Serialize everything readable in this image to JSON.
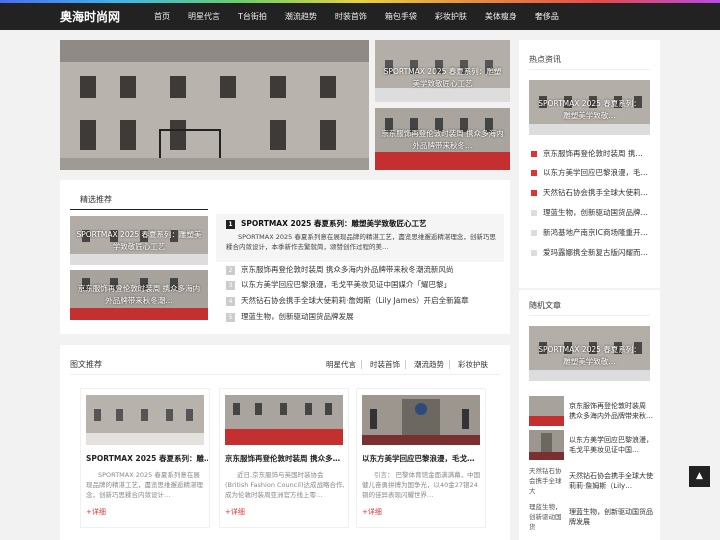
{
  "logo": "奥海时尚网",
  "nav": [
    "首页",
    "明星代言",
    "T台街拍",
    "潮流趋势",
    "时装首饰",
    "箱包手袋",
    "彩妆护肤",
    "美体瘦身",
    "奢侈品"
  ],
  "slider": {
    "small1": "SPORTMAX 2025 春夏系列：雕塑美学致敬匠心工艺",
    "small2": "京东服饰再登伦敦时装周 携众多海内外品牌带来秋冬…"
  },
  "featured": {
    "title": "精选推荐",
    "thumb1": "SPORTMAX 2025 春夏系列：雕塑美学致敬匠心工艺",
    "thumb2": "京东服饰再登伦敦时装周 携众多海内外品牌带来秋冬潮…",
    "lead_num": "1",
    "lead_title": "SPORTMAX 2025 春夏系列：雕塑美学致敬匠心工艺",
    "lead_desc": "SPORTMAX 2025 春夏系列意在展现品牌的精湛工艺，盡览思维邂逅精湛理念，创新巧思糅合内敛设计，本季新作去繁就简，颂赞创作过程的美…",
    "items": [
      {
        "num": "2",
        "text": "京东服饰再登伦敦时装周 携众多海内外品牌带来秋冬潮流新风尚"
      },
      {
        "num": "3",
        "text": "以东方美学回应巴黎浪漫，毛戈平美妆见证中国媒介「耀巴黎」"
      },
      {
        "num": "4",
        "text": "天然钻石协会携手全球大使莉莉·詹姆斯（Lily James）开启全新篇章"
      },
      {
        "num": "5",
        "text": "理蓝生物，创新驱动国货品牌发展"
      }
    ]
  },
  "imgrec": {
    "title": "图文推荐",
    "tabs": [
      "明星代言",
      "时装首饰",
      "潮流趋势",
      "彩妆护肤"
    ],
    "cards": [
      {
        "title": "SPORTMAX 2025 春夏系列：雕…",
        "desc": "SPORTMAX 2025 春夏系列意在展现品牌的精湛工艺，盡览思维邂逅精湛理念，创新巧思糅合内敛设计…",
        "more": "+详细"
      },
      {
        "title": "京东服饰再登伦敦时装周 携众多…",
        "desc": "近日,京东服饰与英国时装协会(British Fashion Council)达成战略合作,成为伦敦时装周亚洲官方线上零…",
        "more": "+详细"
      },
      {
        "title": "以东方美学回应巴黎浪漫，毛戈…",
        "desc": "引言： 巴黎体育馆金面满满幕，中国健儿奋勇拼搏为国争光，以40金27银24铜的佳异表现闪耀世界…",
        "more": "+详细"
      }
    ]
  },
  "hot": {
    "title": "热点资讯",
    "img": "SPORTMAX 2025 春夏系列：雕塑美学致敬…",
    "items": [
      "京东服饰再登伦敦时装周 携…",
      "以东方美学回应巴黎浪漫，毛…",
      "天然钻石协会携手全球大使莉…",
      "理蓝生物，创新驱动国货品牌…",
      "新鸿基地产南京IC商场隆重开…",
      "爱玛露娜携全新复古版闪耀而…"
    ]
  },
  "random": {
    "title": "随机文章",
    "img": "SPORTMAX 2025 春夏系列：雕塑美学致敬…",
    "items": [
      {
        "text": "京东服饰再登伦敦时装周 携众多海内外品牌带来秋…",
        "alt": ""
      },
      {
        "text": "以东方美学回应巴黎浪漫，毛戈平美妆见证中国…",
        "alt": ""
      },
      {
        "text": "天然钻石协会携手全球大使莉莉·詹姆斯（Lily…",
        "alt": "天然钻石协会携手全球大"
      },
      {
        "text": "理蓝生物，创新驱动国货品牌发展",
        "alt": "理蓝生物，创新驱动国货"
      }
    ]
  },
  "colors": {
    "accent": "#d33",
    "header": "#222",
    "hot_squares": [
      "#d33",
      "#d33",
      "#d33",
      "#ddd",
      "#ddd",
      "#ddd"
    ]
  }
}
